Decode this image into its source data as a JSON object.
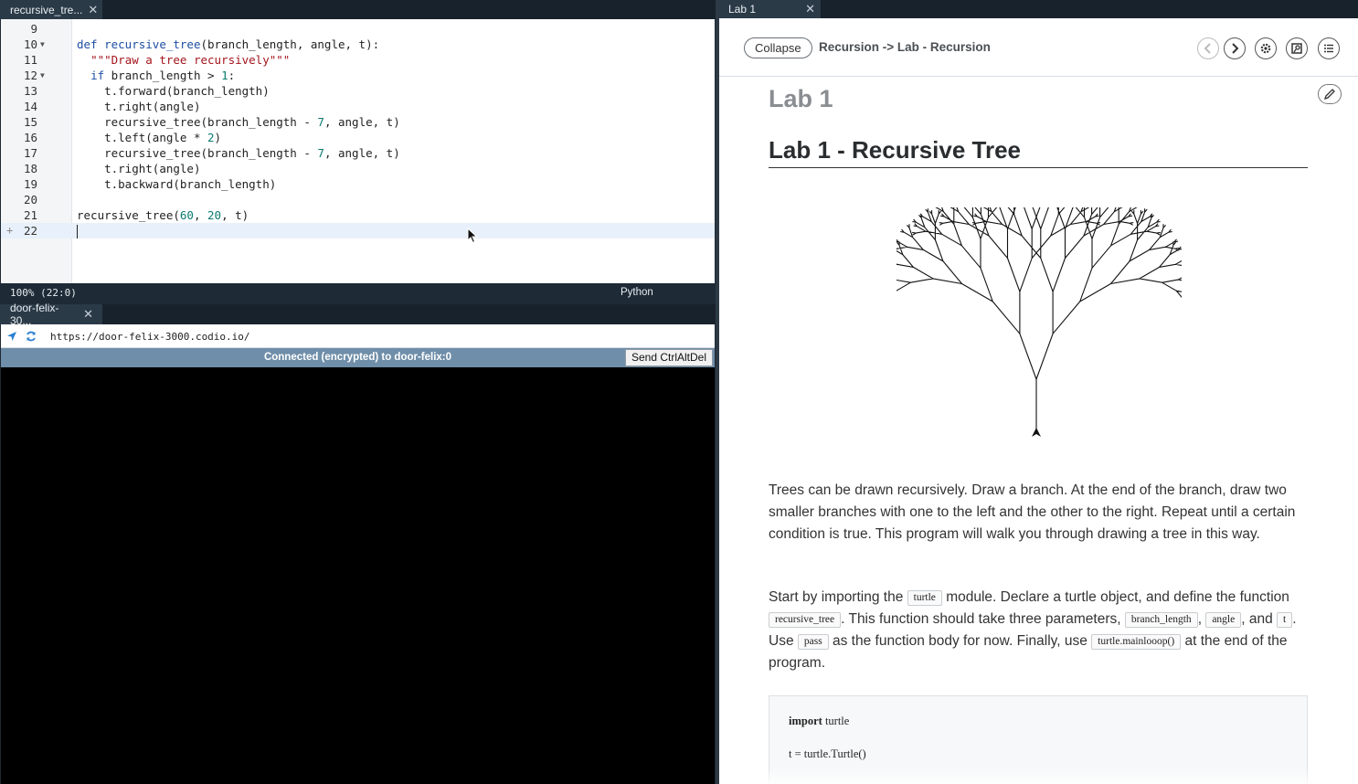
{
  "editor": {
    "tab_label": "recursive_tre...",
    "lines": [
      {
        "num": "9",
        "code": "",
        "fold": ""
      },
      {
        "num": "10",
        "fold": "▼"
      },
      {
        "num": "11",
        "fold": ""
      },
      {
        "num": "12",
        "fold": "▼"
      },
      {
        "num": "13",
        "fold": ""
      },
      {
        "num": "14",
        "fold": ""
      },
      {
        "num": "15",
        "fold": ""
      },
      {
        "num": "16",
        "fold": ""
      },
      {
        "num": "17",
        "fold": ""
      },
      {
        "num": "18",
        "fold": ""
      },
      {
        "num": "19",
        "fold": ""
      },
      {
        "num": "20",
        "fold": ""
      },
      {
        "num": "21",
        "fold": ""
      },
      {
        "num": "22",
        "fold": "",
        "add": "+"
      }
    ],
    "code": {
      "l10_kw": "def",
      "l10_fn": "recursive_tree",
      "l10_rest": "(branch_length, angle, t):",
      "l11_str": "\"\"\"Draw a tree recursively\"\"\"",
      "l12_kw": "if",
      "l12_rest": " branch_length > ",
      "l12_num": "1",
      "l12_end": ":",
      "l13": "t.forward(branch_length)",
      "l14": "t.right(angle)",
      "l15_a": "recursive_tree(branch_length - ",
      "l15_num": "7",
      "l15_b": ", angle, t)",
      "l16_a": "t.left(angle * ",
      "l16_num": "2",
      "l16_b": ")",
      "l17_a": "recursive_tree(branch_length - ",
      "l17_num": "7",
      "l17_b": ", angle, t)",
      "l18": "t.right(angle)",
      "l19": "t.backward(branch_length)",
      "l21_a": "recursive_tree(",
      "l21_n1": "60",
      "l21_c1": ", ",
      "l21_n2": "20",
      "l21_b": ", t)"
    },
    "status_position": "100%  (22:0)",
    "language": "Python"
  },
  "browser": {
    "tab_label": "door-felix-30...",
    "url": "https://door-felix-3000.codio.io/",
    "connection_message": "Connected (encrypted) to door-felix:0",
    "send_button": "Send CtrlAltDel"
  },
  "guide": {
    "tab_label": "Lab 1",
    "collapse_label": "Collapse",
    "breadcrumb": "Recursion -> Lab - Recursion",
    "page_heading": "Lab 1",
    "lab_title": "Lab 1 - Recursive Tree",
    "p1": "Trees can be drawn recursively. Draw a branch. At the end of the branch, draw two smaller branches with one to the left and the other to the right. Repeat until a certain condition is true. This program will walk you through drawing a tree in this way.",
    "p2": {
      "t1": "Start by importing the ",
      "c1": "turtle",
      "t2": " module. Declare a turtle object, and define the function ",
      "c2": "recursive_tree",
      "t3": ". This function should take three parameters, ",
      "c3": "branch_length",
      "t4": ",",
      "c4": "angle",
      "t5": ", and ",
      "c5": "t",
      "t6": ". Use ",
      "c6": "pass",
      "t7": " as the function body for now. Finally, use ",
      "c7": "turtle.mainlooop()",
      "t8": " at the end of the program."
    },
    "code_sample": {
      "l1_kw": "import",
      "l1_rest": " turtle",
      "l2": "t = turtle.Turtle()"
    }
  },
  "colors": {
    "dark_bg": "#1e2a35",
    "vnc_bar": "#6f8ea9",
    "keyword": "#1d4ea3",
    "string": "#a3151c",
    "number": "#0b7a70"
  }
}
